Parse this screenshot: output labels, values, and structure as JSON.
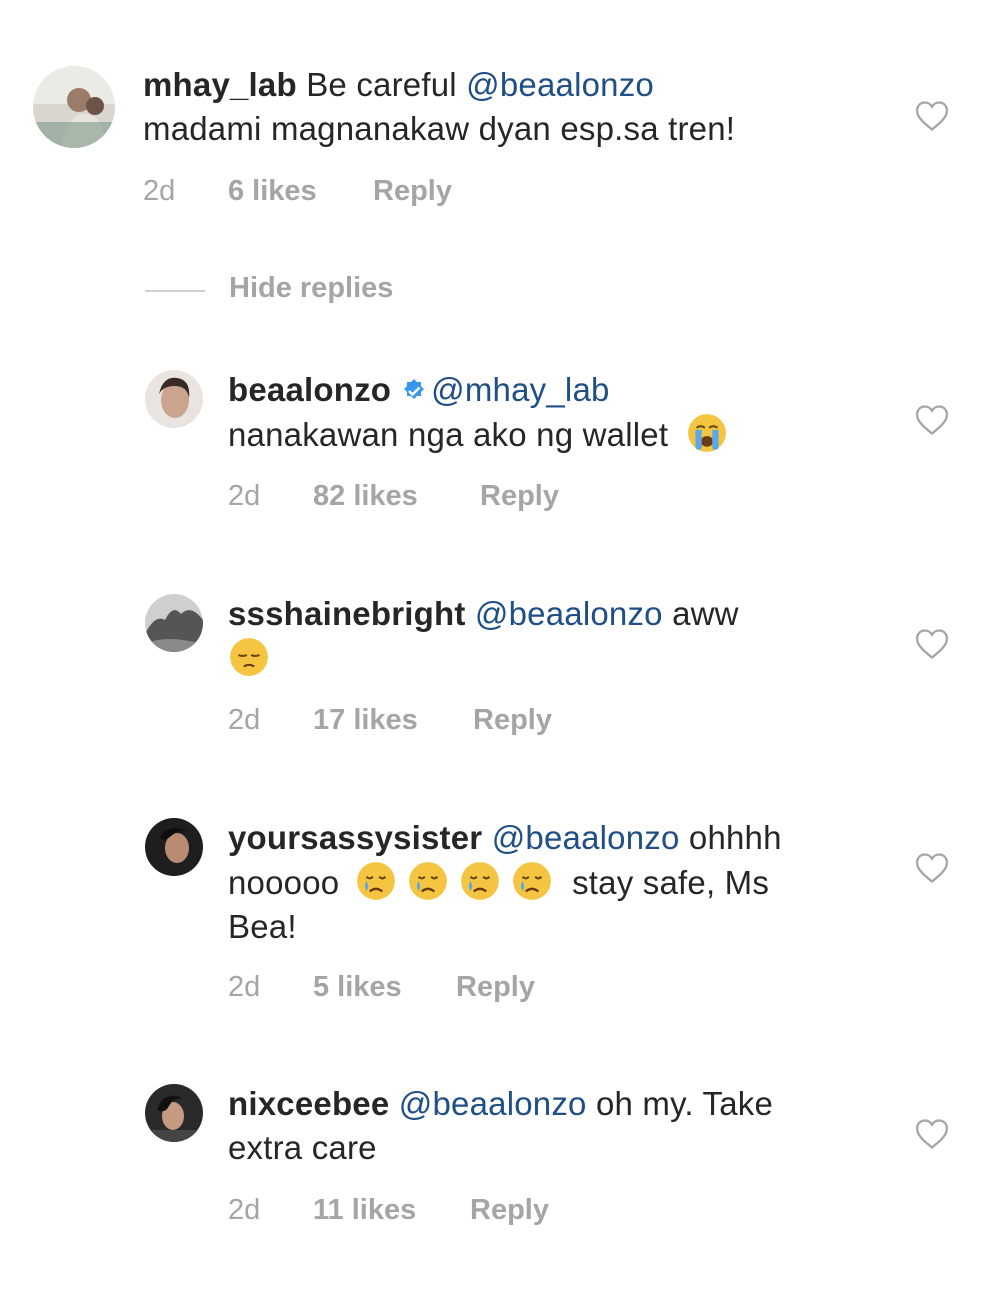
{
  "comments": [
    {
      "username": "mhay_lab",
      "text_before": "Be careful ",
      "mention": "@beaalonzo",
      "line2": "madami magnanakaw dyan esp.sa tren!",
      "time": "2d",
      "likes": "6 likes",
      "reply": "Reply"
    },
    {
      "username": "beaalonzo",
      "verified": true,
      "mention": "@mhay_lab",
      "line2": "nanakawan nga ako ng wallet",
      "emoji": "loudly-crying-face",
      "time": "2d",
      "likes": "82 likes",
      "reply": "Reply"
    },
    {
      "username": "ssshainebright",
      "mention": "@beaalonzo",
      "text_after": " aww",
      "emoji": "pensive-face",
      "time": "2d",
      "likes": "17 likes",
      "reply": "Reply"
    },
    {
      "username": "yoursassysister",
      "mention": "@beaalonzo",
      "text_after": " ohhhh",
      "line2_start": "nooooo",
      "emoji": "crying-face",
      "line2_end": "stay safe, Ms",
      "line3": "Bea!",
      "time": "2d",
      "likes": "5 likes",
      "reply": "Reply"
    },
    {
      "username": "nixceebee",
      "mention": "@beaalonzo",
      "text_after": " oh my. Take",
      "line2": "extra care",
      "time": "2d",
      "likes": "11 likes",
      "reply": "Reply"
    }
  ],
  "hide_replies_label": "Hide replies",
  "colors": {
    "username": "#262626",
    "mention": "#1f4f86",
    "meta": "#a5a5a5",
    "verified": "#3897f0"
  }
}
